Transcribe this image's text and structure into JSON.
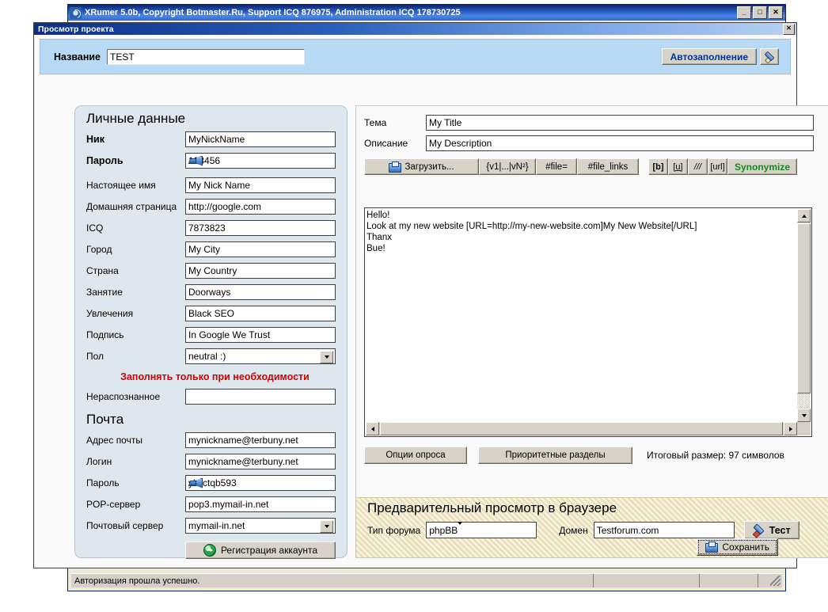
{
  "app_window": {
    "title": "XRumer 5.0b, Copyright Botmaster.Ru, Support ICQ 876975, Administration ICQ 178730725",
    "minimize_label": "_",
    "maximize_label": "□",
    "close_label": "✕"
  },
  "status_bar": {
    "message": "Авторизация прошла успешно.",
    "pane2": "",
    "pane3": ""
  },
  "dialog": {
    "title": "Просмотр проекта",
    "close_label": "✕",
    "name_label": "Название",
    "name_value": "TEST",
    "autofill_label": "Автозаполнение",
    "save_label": "Сохранить"
  },
  "personal": {
    "heading": "Личные данные",
    "fields": [
      {
        "label": "Ник",
        "value": "MyNickName",
        "bold": true,
        "key": false
      },
      {
        "label": "Пароль",
        "value": "123456",
        "bold": true,
        "key": true
      },
      {
        "label": "Настоящее имя",
        "value": "My Nick Name",
        "bold": false,
        "key": false
      },
      {
        "label": "Домашняя страница",
        "value": "http://google.com",
        "bold": false,
        "key": false
      },
      {
        "label": "ICQ",
        "value": "7873823",
        "bold": false,
        "key": false
      },
      {
        "label": "Город",
        "value": "My City",
        "bold": false,
        "key": false
      },
      {
        "label": "Страна",
        "value": "My Country",
        "bold": false,
        "key": false
      },
      {
        "label": "Занятие",
        "value": "Doorways",
        "bold": false,
        "key": false
      },
      {
        "label": "Увлечения",
        "value": "Black SEO",
        "bold": false,
        "key": false
      },
      {
        "label": "Подпись",
        "value": "In Google We Trust",
        "bold": false,
        "key": false
      }
    ],
    "gender_label": "Пол",
    "gender_value": "neutral :)",
    "warning": "Заполнять только при необходимости",
    "unrecognized_label": "Нераспознанное",
    "unrecognized_value": ""
  },
  "mail": {
    "heading": "Почта",
    "fields": [
      {
        "label": "Адрес почты",
        "value": "mynickname@terbuny.net",
        "key": false
      },
      {
        "label": "Логин",
        "value": "mynickname@terbuny.net",
        "key": false
      },
      {
        "label": "Пароль",
        "value": "ykkctqb593",
        "key": true
      },
      {
        "label": "POP-сервер",
        "value": "pop3.mymail-in.net",
        "key": false
      }
    ],
    "server_label": "Почтовый сервер",
    "server_value": "mymail-in.net",
    "register_label": "Регистрация аккаунта"
  },
  "message": {
    "subject_label": "Тема",
    "subject_value": "My Title",
    "description_label": "Описание",
    "description_value": "My Description",
    "toolbar": {
      "upload": "Загрузить...",
      "spintax": "{v1|...|vN²}",
      "file": "#file=",
      "file_links": "#file_links",
      "bold": "[b]",
      "underline": "[u]",
      "italic": "///",
      "url": "[url]",
      "synonymize": "Synonymize"
    },
    "body": "Hello!\nLook at my new website [URL=http://my-new-website.com]My New Website[/URL]\nThanx\nBue!",
    "poll_options_label": "Опции опроса",
    "priority_sections_label": "Приоритетные разделы",
    "size_text": "Итоговый размер: 97 символов"
  },
  "preview": {
    "heading": "Предварительный просмотр в браузере",
    "forum_type_label": "Тип форума",
    "forum_type_value": "phpBB",
    "domain_label": "Домен",
    "domain_value": "Testforum.com",
    "test_label": "Тест"
  },
  "colors": {
    "accent_blue": "#00339c",
    "warning_red": "#d40000",
    "synonymize_green": "#0f8a20",
    "panel_blue": "#b9daf5",
    "preview_cream": "#f2ecd0"
  }
}
